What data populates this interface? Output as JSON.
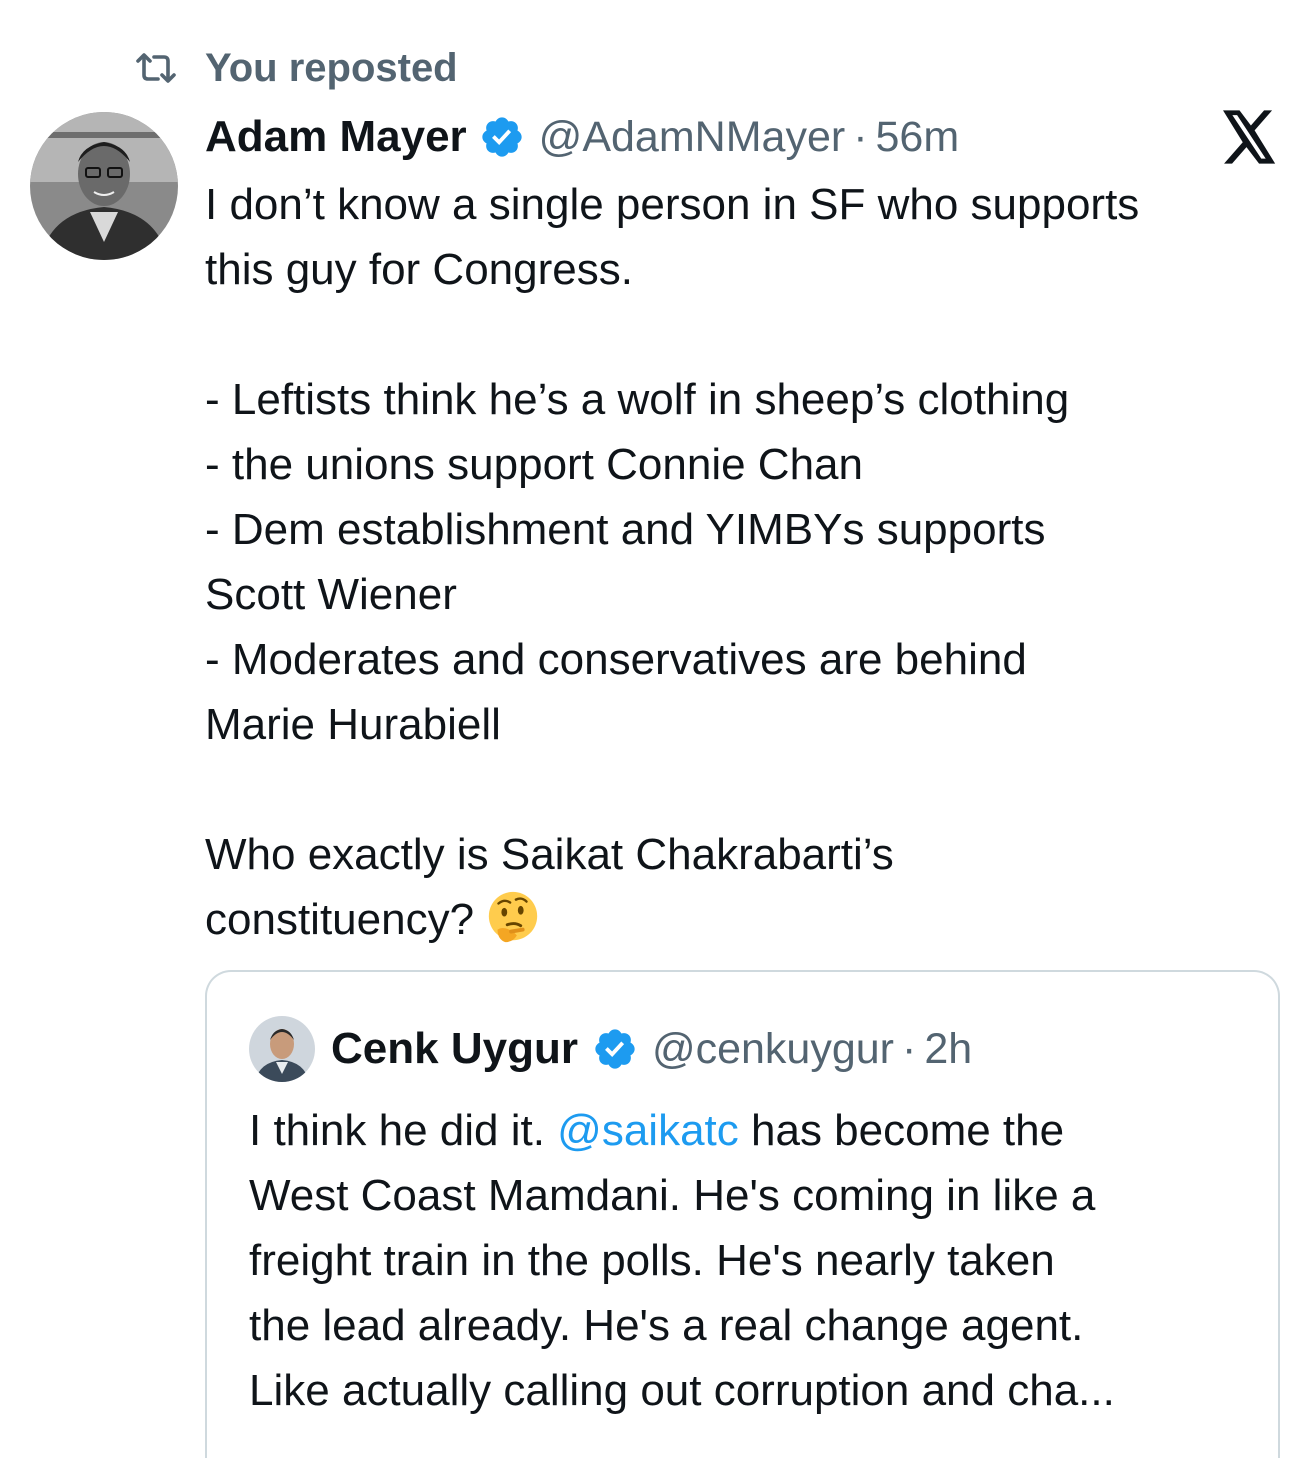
{
  "repost": {
    "icon": "repost-icon",
    "label": "You reposted"
  },
  "tweet": {
    "author": {
      "name": "Adam Mayer",
      "handle": "@AdamNMayer",
      "verified_icon": "verified-badge-icon",
      "avatar_icon": "avatar-photo"
    },
    "time": "56m",
    "separator": "·",
    "platform_icon": "x-logo-icon",
    "lines": [
      "I don’t know a single person in SF who supports",
      "this guy for Congress.",
      "",
      "- Leftists think he’s a wolf in sheep’s clothing",
      "-  the unions support Connie Chan",
      "- Dem establishment and YIMBYs supports",
      "Scott Wiener",
      "- Moderates and conservatives are behind",
      "Marie Hurabiell",
      "",
      "Who exactly is Saikat Chakrabarti’s",
      "constituency?"
    ],
    "emoji_icon": "thinking-face-emoji"
  },
  "quoted": {
    "author": {
      "name": "Cenk Uygur",
      "handle": "@cenkuygur",
      "verified_icon": "verified-badge-icon",
      "avatar_icon": "avatar-photo"
    },
    "time": "2h",
    "separator": "·",
    "line1_before": "I think he did it. ",
    "mention": "@saikatc",
    "line1_after": " has become the",
    "lines": [
      "West Coast Mamdani. He's coming in like a",
      "freight train in the polls. He's nearly taken",
      "the lead already. He's a real change agent.",
      "Like actually calling out corruption and cha..."
    ]
  },
  "colors": {
    "verified": "#1d9bf0",
    "secondary": "#536471",
    "link": "#1d9bf0",
    "border": "#cfd9de"
  }
}
